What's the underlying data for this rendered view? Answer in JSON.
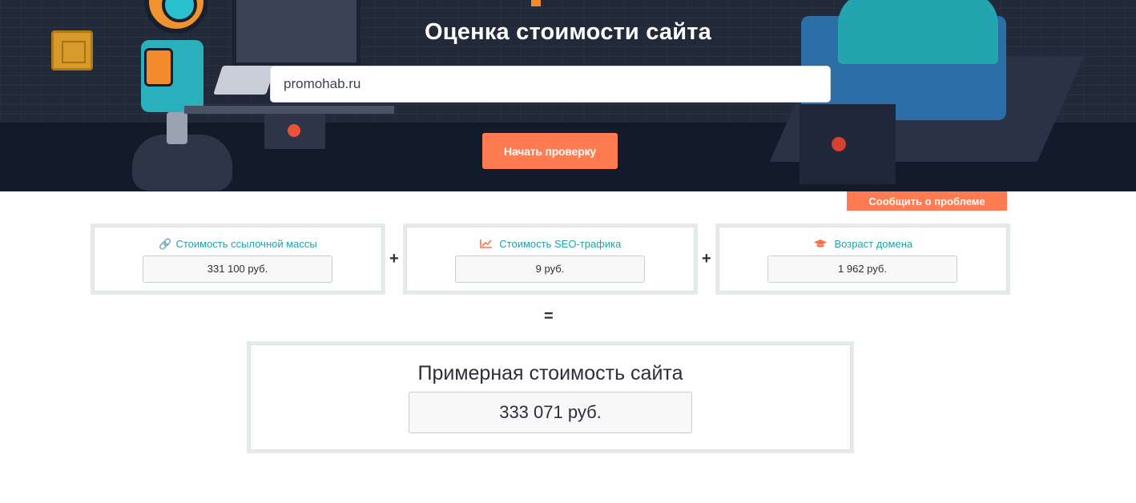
{
  "hero": {
    "title": "Оценка стоимости сайта",
    "input_value": "promohab.ru",
    "start_button": "Начать проверку"
  },
  "report_button": "Сообщить о проблеме",
  "cards": [
    {
      "title": "Стоимость ссылочной массы",
      "icon": "link-icon",
      "value": "331 100 руб."
    },
    {
      "title": "Стоимость SEO-трафика",
      "icon": "chart-line-icon",
      "value": "9 руб."
    },
    {
      "title": "Возраст домена",
      "icon": "graduation-cap-icon",
      "value": "1 962 руб."
    }
  ],
  "operators": {
    "plus": "+",
    "equals": "="
  },
  "total": {
    "title": "Примерная стоимость сайта",
    "value": "333 071 руб."
  },
  "colors": {
    "accent": "#ff7b52",
    "teal": "#1fa3aa",
    "hero_bg": "#222a3a"
  }
}
